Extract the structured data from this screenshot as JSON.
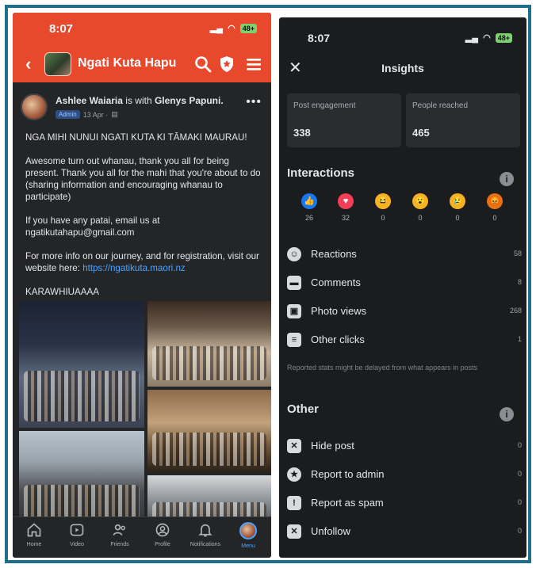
{
  "left": {
    "status_time": "8:07",
    "battery": "48+",
    "group_name": "Ngati Kuta Hapu",
    "post": {
      "author": "Ashlee Waiaria",
      "with_text": "is with",
      "tagged": "Glenys Papuni.",
      "badge": "Admin",
      "date": "13 Apr ·",
      "paragraphs": [
        "NGA MIHI NUNUI NGATI KUTA KI TĀMAKI MAURAU!",
        "Awesome turn out whanau, thank you all for being present. Thank you all for the mahi that you're about to do (sharing information and encouraging whanau to participate)",
        "If you have any patai, email us at ngatikutahapu@gmail.com"
      ],
      "info_text": "For more info on our journey, and for registration, visit our website here: ",
      "link": "https://ngatikuta.maori.nz",
      "closing": "KARAWHIUAAAA"
    },
    "tabs": [
      {
        "label": "Home",
        "icon": "home-icon"
      },
      {
        "label": "Video",
        "icon": "video-icon"
      },
      {
        "label": "Friends",
        "icon": "friends-icon"
      },
      {
        "label": "Profile",
        "icon": "profile-icon"
      },
      {
        "label": "Notifications",
        "icon": "bell-icon"
      },
      {
        "label": "Menu",
        "icon": "menu-avatar"
      }
    ],
    "accent_color": "#e8492d"
  },
  "right": {
    "status_time": "8:07",
    "battery": "48+",
    "title": "Insights",
    "stats": [
      {
        "label": "Post engagement",
        "value": "338"
      },
      {
        "label": "People reached",
        "value": "465"
      }
    ],
    "interactions_title": "Interactions",
    "reactions": [
      {
        "type": "like",
        "count": "26",
        "color": "#1877f2",
        "glyph": "👍"
      },
      {
        "type": "love",
        "count": "32",
        "color": "#f33e58",
        "glyph": "♥"
      },
      {
        "type": "haha",
        "count": "0",
        "color": "#f7b125",
        "glyph": "😆"
      },
      {
        "type": "wow",
        "count": "0",
        "color": "#f7b125",
        "glyph": "😮"
      },
      {
        "type": "sad",
        "count": "0",
        "color": "#f7b125",
        "glyph": "😢"
      },
      {
        "type": "angry",
        "count": "0",
        "color": "#e9710f",
        "glyph": "😡"
      }
    ],
    "interaction_rows": [
      {
        "label": "Reactions",
        "value": "58",
        "icon": "smiley-icon"
      },
      {
        "label": "Comments",
        "value": "8",
        "icon": "comment-icon"
      },
      {
        "label": "Photo views",
        "value": "268",
        "icon": "photo-icon"
      },
      {
        "label": "Other clicks",
        "value": "1",
        "icon": "clicks-icon"
      }
    ],
    "note": "Reported stats might be delayed from what appears in posts",
    "other_title": "Other",
    "other_rows": [
      {
        "label": "Hide post",
        "value": "0",
        "icon": "hide-icon"
      },
      {
        "label": "Report to admin",
        "value": "0",
        "icon": "report-admin-icon"
      },
      {
        "label": "Report as spam",
        "value": "0",
        "icon": "spam-icon"
      },
      {
        "label": "Unfollow",
        "value": "0",
        "icon": "unfollow-icon"
      }
    ]
  }
}
